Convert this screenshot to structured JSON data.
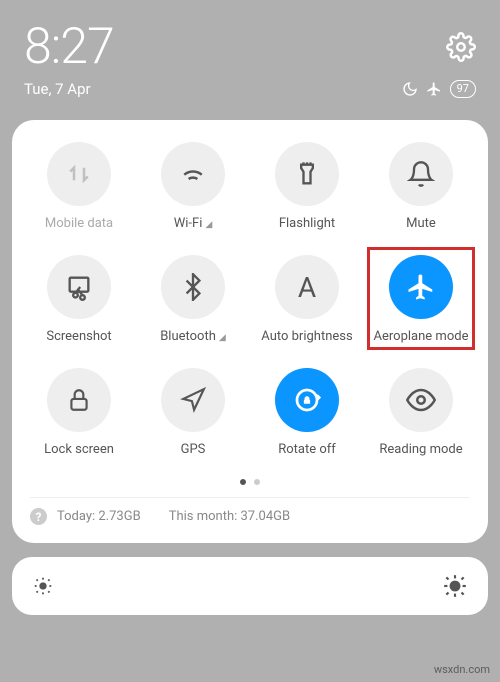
{
  "status": {
    "time": "8:27",
    "date": "Tue, 7 Apr",
    "battery": "97"
  },
  "tiles": {
    "mobile_data": "Mobile data",
    "wifi": "Wi-Fi",
    "flashlight": "Flashlight",
    "mute": "Mute",
    "screenshot": "Screenshot",
    "bluetooth": "Bluetooth",
    "auto_brightness": "Auto brightness",
    "aeroplane_mode": "Aeroplane mode",
    "lock_screen": "Lock screen",
    "gps": "GPS",
    "rotate_off": "Rotate off",
    "reading_mode": "Reading mode"
  },
  "data_usage": {
    "today": "Today: 2.73GB",
    "month": "This month: 37.04GB"
  },
  "watermark": "wsxdn.com"
}
